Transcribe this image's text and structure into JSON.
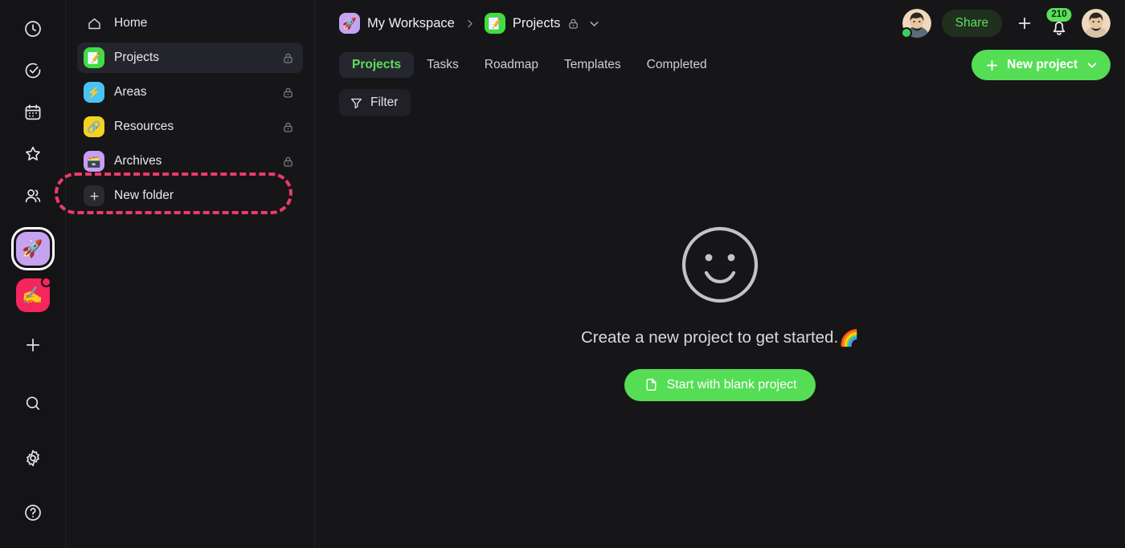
{
  "colors": {
    "app_bg": "#161618",
    "rail_bg": "#141416",
    "accent_green": "#55dd55",
    "accent_green_text": "#5ae05a",
    "annotation_pink": "#ee3a6b",
    "selected_row": "#24242c",
    "status_online": "#3fcf5c",
    "badge_dot": "#f5255e"
  },
  "rail": {
    "items": [
      {
        "name": "clock-icon",
        "label": "Recent"
      },
      {
        "name": "check-circle-icon",
        "label": "Tasks"
      },
      {
        "name": "calendar-icon",
        "label": "Calendar"
      },
      {
        "name": "star-icon",
        "label": "Favorites"
      },
      {
        "name": "people-icon",
        "label": "Contacts"
      }
    ],
    "workspaces": [
      {
        "name": "workspace-my-workspace",
        "emoji": "🚀",
        "bg": "#c5a3f0",
        "active": true,
        "has_dot": false
      },
      {
        "name": "workspace-writing",
        "emoji": "✍️",
        "bg": "#f5255e",
        "active": false,
        "has_dot": true
      }
    ],
    "add_workspace": {
      "name": "add-workspace-button",
      "glyph": "+"
    },
    "bottom": [
      {
        "name": "search-icon",
        "label": "Search"
      },
      {
        "name": "settings-icon",
        "label": "Settings"
      },
      {
        "name": "help-icon",
        "label": "Help"
      }
    ]
  },
  "sidebar": {
    "items": [
      {
        "label": "Home",
        "icon": "home-icon",
        "icon_emoji": "",
        "icon_bg": "transparent",
        "locked": false,
        "selected": false,
        "is_add": false
      },
      {
        "label": "Projects",
        "icon": "projects-folder-icon",
        "icon_emoji": "📝",
        "icon_bg": "#3ede3e",
        "locked": true,
        "selected": true,
        "is_add": false
      },
      {
        "label": "Areas",
        "icon": "areas-folder-icon",
        "icon_emoji": "⚡",
        "icon_bg": "#49c3f5",
        "locked": true,
        "selected": false,
        "is_add": false
      },
      {
        "label": "Resources",
        "icon": "resources-folder-icon",
        "icon_emoji": "🔗",
        "icon_bg": "#f5d21e",
        "locked": true,
        "selected": false,
        "is_add": false
      },
      {
        "label": "Archives",
        "icon": "archives-folder-icon",
        "icon_emoji": "🗃️",
        "icon_bg": "#c79df5",
        "locked": true,
        "selected": false,
        "is_add": false
      },
      {
        "label": "New folder",
        "icon": "plus-icon",
        "icon_emoji": "+",
        "icon_bg": "#2a2a31",
        "locked": false,
        "selected": false,
        "is_add": true
      }
    ],
    "annotation": {
      "name": "new-folder-highlight",
      "target": "New folder",
      "style": "dashed-ellipse"
    }
  },
  "header": {
    "breadcrumb": {
      "workspace": {
        "label": "My Workspace",
        "emoji": "🚀",
        "bg": "#c5a3f0"
      },
      "separator": "›",
      "current": {
        "label": "Projects",
        "emoji": "📝",
        "bg": "#3ede3e",
        "locked": true,
        "has_dropdown": true
      }
    },
    "share_label": "Share",
    "notification_count": "210",
    "avatars": [
      {
        "name": "avatar-collaborator",
        "online": true
      },
      {
        "name": "avatar-current-user",
        "online": false
      }
    ]
  },
  "tabs": [
    {
      "label": "Projects",
      "active": true
    },
    {
      "label": "Tasks",
      "active": false
    },
    {
      "label": "Roadmap",
      "active": false
    },
    {
      "label": "Templates",
      "active": false
    },
    {
      "label": "Completed",
      "active": false
    }
  ],
  "toolbar": {
    "new_project_label": "New project",
    "filter_label": "Filter"
  },
  "empty_state": {
    "message": "Create a new project to get started.",
    "message_emoji": "🌈",
    "button_label": "Start with blank project"
  }
}
